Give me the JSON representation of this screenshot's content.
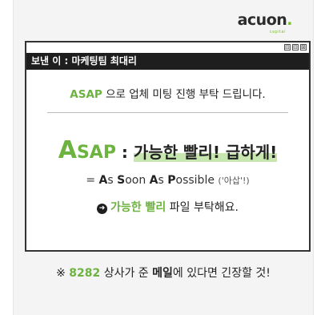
{
  "logo": {
    "text": "acuon",
    "dot": ".",
    "sub": "capital"
  },
  "window": {
    "controls": [
      "⊟",
      "⊟",
      "⊠"
    ],
    "title": "보낸 이 : 마케팅팀 최대리"
  },
  "message": {
    "line1_em": "ASAP",
    "line1_rest": " 으로 업체 미팅 진행 부탁 드립니다.",
    "headline_a": "A",
    "headline_sap": "SAP",
    "headline_colon": " : ",
    "headline_ko": "가능한 빨리! 급하게!",
    "def_prefix": "= ",
    "def_words": [
      {
        "cap": "A",
        "rest": "s "
      },
      {
        "cap": "S",
        "rest": "oon "
      },
      {
        "cap": "A",
        "rest": "s "
      },
      {
        "cap": "P",
        "rest": "ossible "
      }
    ],
    "def_note": "('아삽'!)",
    "line4_icon": "➜",
    "line4_em": "가능한 빨리",
    "line4_rest": " 파일 부탁해요."
  },
  "footer": {
    "prefix": "※ ",
    "num": "8282",
    "mid": " 상사가 준 ",
    "bold": "메일",
    "end": "에 있다면 긴장할 것!"
  }
}
